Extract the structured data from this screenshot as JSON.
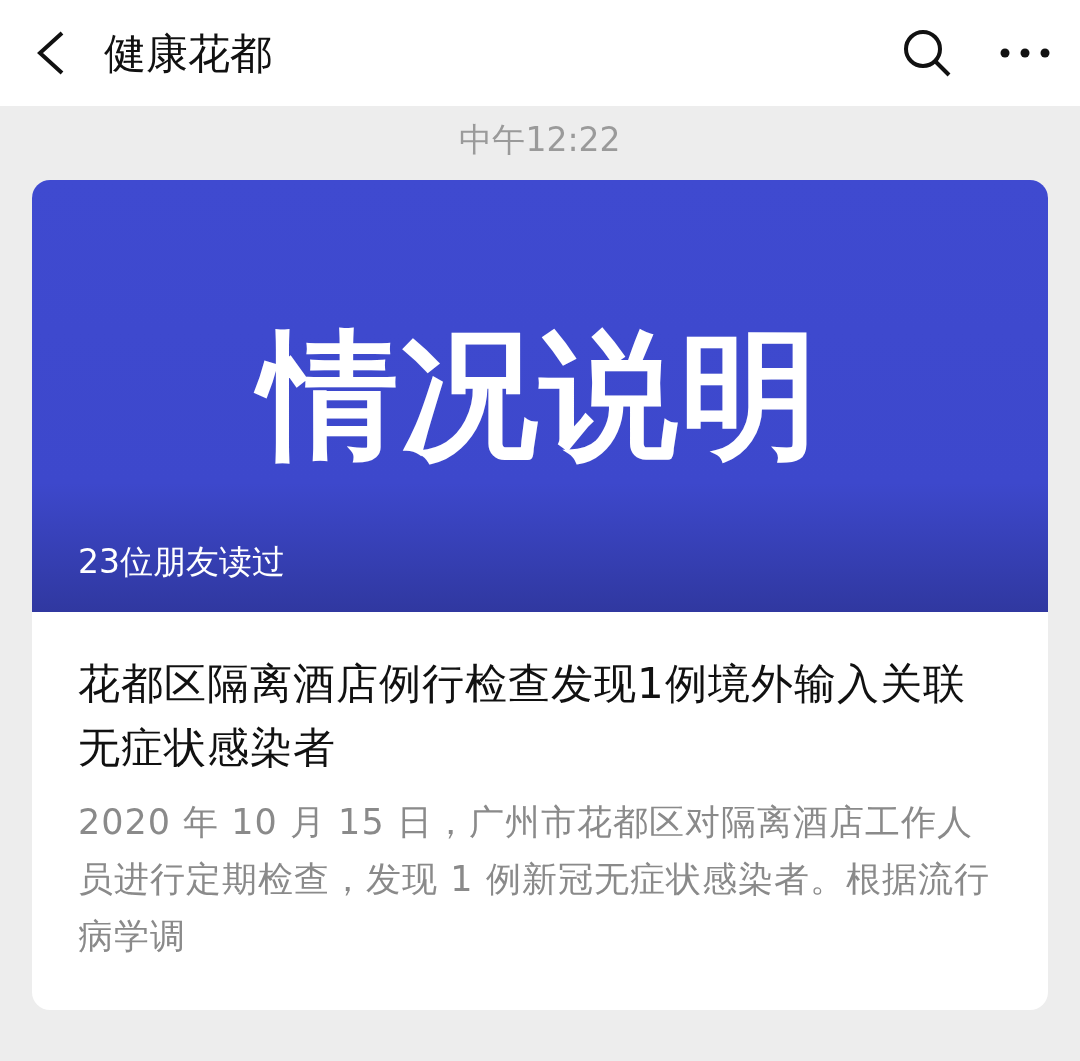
{
  "header": {
    "title": "健康花都"
  },
  "timestamp": "中午12:22",
  "article": {
    "cover": {
      "text": "情况说明",
      "read_count": "23位朋友读过"
    },
    "title": "花都区隔离酒店例行检查发现1例境外输入关联无症状感染者",
    "summary": "2020 年 10 月 15 日，广州市花都区对隔离酒店工作人员进行定期检查，发现 1 例新冠无症状感染者。根据流行病学调"
  }
}
